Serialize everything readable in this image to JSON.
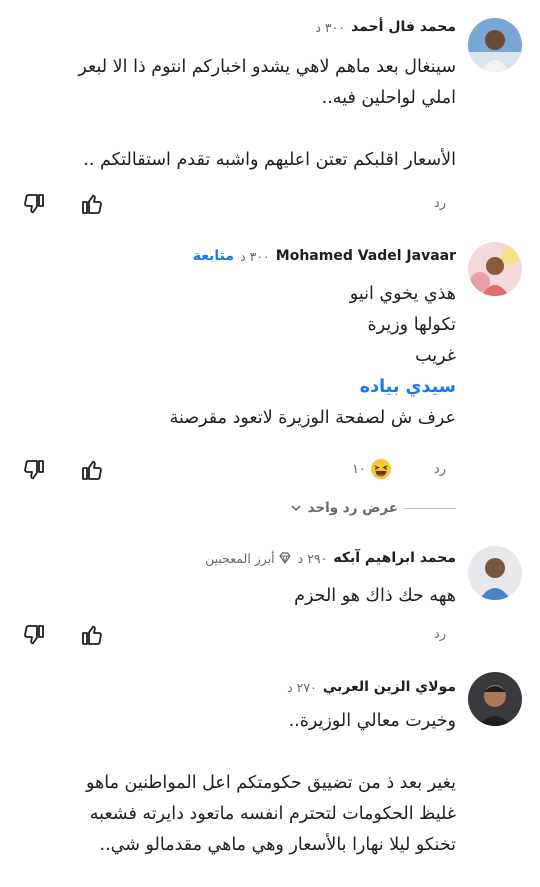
{
  "reply_label": "رد",
  "comments": [
    {
      "author": "محمد فال أحمد",
      "time": "٣٠٠ د",
      "lines": [
        "سينغال بعد ماهم لاهي يشدو اخباركم انتوم ذا الا لبعر",
        "املي لواحلين فيه..",
        "",
        "الأسعار اقلبكم تعتن اعليهم واشبه تقدم استقالتكم .."
      ]
    },
    {
      "author": "Mohamed Vadel Javaar",
      "time": "٣٠٠ د",
      "follow": "متابعة",
      "lines": [
        "هذي يخوي انيو",
        "تكولها وزيرة",
        "غريب"
      ],
      "mention": "سيدي بياده",
      "after_mention": "عرف ش لصفحة الوزيرة لاتعود مقرصنة",
      "reaction_count": "١٠",
      "view_replies": "عرض رد واحد"
    },
    {
      "author": "محمد ابراهيم آبكه",
      "time": "٢٩٠ د",
      "badge": "أبرز المعجبين",
      "lines": [
        "ههه حك ذاك هو الحزم"
      ]
    },
    {
      "author": "مولاي الزين العربي",
      "time": "٢٧٠ د",
      "lines": [
        "وخيرت معالي الوزيرة..",
        "",
        "يغير بعد ذ من تضييق حكومتكم اعل المواطنين ماهو",
        "غليظ الحكومات لتحترم انفسه ماتعود دايرته فشعبه",
        "تخنكو ليلا نهارا بالأسعار وهي ماهي مقدمالو شي.."
      ]
    }
  ],
  "colors": {
    "link": "#1877f2",
    "meta": "#65676b",
    "text": "#1c1e21"
  },
  "icons": [
    "like-icon",
    "dislike-icon",
    "laughing-emoji-icon",
    "top-fan-diamond-icon",
    "chevron-down-icon"
  ]
}
